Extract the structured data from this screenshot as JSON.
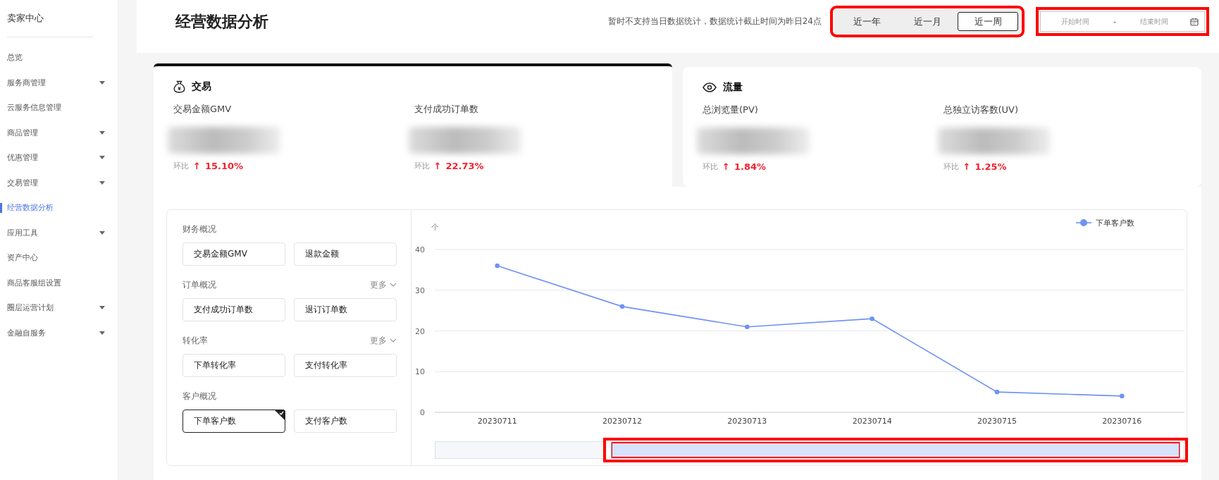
{
  "sidebar": {
    "title": "卖家中心",
    "items": [
      {
        "label": "总览",
        "selected": false,
        "expandable": false
      },
      {
        "label": "服务商管理",
        "selected": false,
        "expandable": true
      },
      {
        "label": "云服务信息管理",
        "selected": false,
        "expandable": false
      },
      {
        "label": "商品管理",
        "selected": false,
        "expandable": true
      },
      {
        "label": "优惠管理",
        "selected": false,
        "expandable": true
      },
      {
        "label": "交易管理",
        "selected": false,
        "expandable": true
      },
      {
        "label": "经营数据分析",
        "selected": true,
        "expandable": false
      },
      {
        "label": "应用工具",
        "selected": false,
        "expandable": true
      },
      {
        "label": "资产中心",
        "selected": false,
        "expandable": false
      },
      {
        "label": "商品客服组设置",
        "selected": false,
        "expandable": false
      },
      {
        "label": "圈层运营计划",
        "selected": false,
        "expandable": true
      },
      {
        "label": "金融自服务",
        "selected": false,
        "expandable": true
      }
    ]
  },
  "header": {
    "title": "经营数据分析",
    "notice": "暂时不支持当日数据统计，数据统计截止时间为昨日24点",
    "range_tabs": {
      "highlighted": true,
      "tabs": [
        {
          "label": "近一年",
          "selected": false
        },
        {
          "label": "近一月",
          "selected": false
        },
        {
          "label": "近一周",
          "selected": true
        }
      ]
    },
    "date_range": {
      "highlighted": true,
      "start_placeholder": "开始时间",
      "separator": "-",
      "end_placeholder": "结束时间"
    }
  },
  "cards": [
    {
      "kind": "trade",
      "icon_glyph": "¥",
      "title": "交易",
      "selected": true,
      "metrics": [
        {
          "label": "交易金额GMV",
          "compare_label": "环比",
          "arrow": "↑",
          "change": "15.10%"
        },
        {
          "label": "支付成功订单数",
          "compare_label": "环比",
          "arrow": "↑",
          "change": "22.73%"
        }
      ]
    },
    {
      "kind": "traffic",
      "title": "流量",
      "selected": false,
      "metrics": [
        {
          "label": "总浏览量(PV)",
          "compare_label": "环比",
          "arrow": "↑",
          "change": "1.84%"
        },
        {
          "label": "总独立访客数(UV)",
          "compare_label": "环比",
          "arrow": "↑",
          "change": "1.25%"
        }
      ]
    }
  ],
  "indicator_groups": [
    {
      "title": "财务概况",
      "items": [
        {
          "label": "交易金额GMV",
          "selected": false
        },
        {
          "label": "退款金额",
          "selected": false
        }
      ]
    },
    {
      "title": "订单概况",
      "more": "更多",
      "items": [
        {
          "label": "支付成功订单数",
          "selected": false
        },
        {
          "label": "退订订单数",
          "selected": false
        }
      ]
    },
    {
      "title": "转化率",
      "more": "更多",
      "items": [
        {
          "label": "下单转化率",
          "selected": false
        },
        {
          "label": "支付转化率",
          "selected": false
        }
      ]
    },
    {
      "title": "客户概况",
      "items": [
        {
          "label": "下单客户数",
          "selected": true
        },
        {
          "label": "支付客户数",
          "selected": false
        }
      ]
    }
  ],
  "chart": {
    "zoom_slider": {
      "highlighted": true,
      "level": 0.77
    },
    "chart_data": {
      "type": "line",
      "ylabel": "个",
      "categories": [
        "20230711",
        "20230712",
        "20230713",
        "20230714",
        "20230715",
        "20230716"
      ],
      "series": [
        {
          "name": "下单客户数",
          "color": "#6f93f3",
          "values": [
            36,
            26,
            21,
            23,
            5,
            4
          ]
        }
      ],
      "ylim": [
        0,
        40
      ],
      "yticks": [
        0,
        10,
        20,
        30,
        40
      ],
      "grid": true,
      "marker": true
    }
  }
}
